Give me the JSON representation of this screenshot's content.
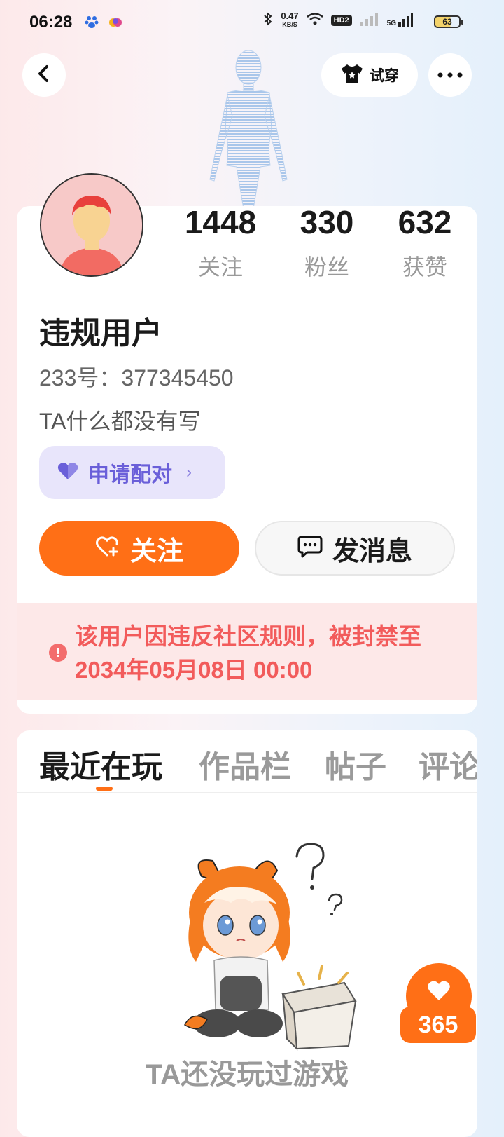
{
  "status_bar": {
    "time": "06:28",
    "net_speed": "0.47",
    "net_unit": "KB/S",
    "hd_badge": "HD2",
    "network": "5G",
    "battery": "63"
  },
  "header": {
    "tryon_label": "试穿",
    "icons": [
      "back-icon",
      "tshirt-icon",
      "more-icon"
    ]
  },
  "profile": {
    "stats": [
      {
        "value": "1448",
        "label": "关注"
      },
      {
        "value": "330",
        "label": "粉丝"
      },
      {
        "value": "632",
        "label": "获赞"
      }
    ],
    "username": "违规用户",
    "user_id": "233号：377345450",
    "bio": "TA什么都没有写",
    "pair_label": "申请配对",
    "follow_label": "关注",
    "message_label": "发消息",
    "ban_notice": "该用户因违反社区规则，被封禁至2034年05月08日 00:00"
  },
  "tabs": {
    "items": [
      {
        "label": "最近在玩",
        "active": true
      },
      {
        "label": "作品栏",
        "active": false
      },
      {
        "label": "帖子",
        "active": false
      },
      {
        "label": "评论",
        "active": false
      }
    ]
  },
  "empty_state": {
    "text": "TA还没玩过游戏"
  },
  "floating_like": {
    "count": "365"
  },
  "colors": {
    "accent": "#ff6f16",
    "pair_bg": "#e8e5fb",
    "pair_text": "#6a5fd9",
    "ban_bg": "#fde8e8",
    "ban_text": "#f25b5b"
  }
}
